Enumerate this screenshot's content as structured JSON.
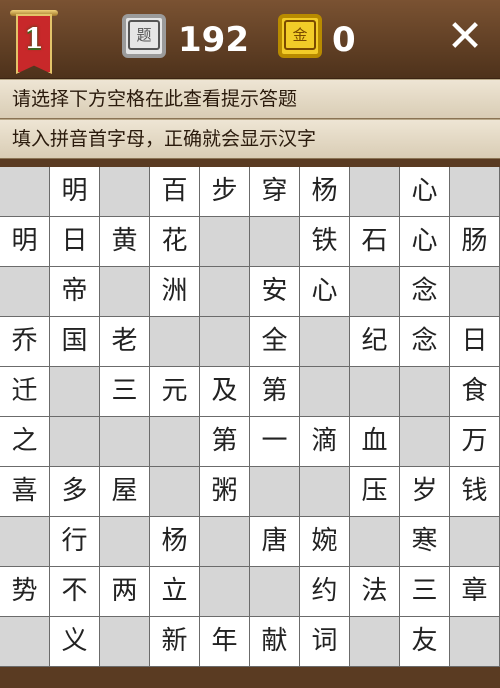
{
  "header": {
    "level": "1",
    "question_icon_glyph": "题",
    "question_count": "192",
    "gold_icon_glyph": "金",
    "gold_count": "0",
    "close_glyph": "✕"
  },
  "hints": [
    "请选择下方空格在此查看提示答题",
    "填入拼音首字母，正确就会显示汉字"
  ],
  "colors": {
    "wood": "#5a3b22",
    "cell_filled": "#ffffff",
    "cell_empty": "#d6d6d6",
    "level_banner": "#c8282a",
    "gold_badge": "#f2cc28"
  },
  "grid": [
    [
      "",
      "明",
      "",
      "百",
      "步",
      "穿",
      "杨",
      "",
      "心",
      ""
    ],
    [
      "明",
      "日",
      "黄",
      "花",
      "",
      "",
      "铁",
      "石",
      "心",
      "肠"
    ],
    [
      "",
      "帝",
      "",
      "洲",
      "",
      "安",
      "心",
      "",
      "念",
      ""
    ],
    [
      "乔",
      "国",
      "老",
      "",
      "",
      "全",
      "",
      "纪",
      "念",
      "日"
    ],
    [
      "迁",
      "",
      "三",
      "元",
      "及",
      "第",
      "",
      "",
      "",
      "食"
    ],
    [
      "之",
      "",
      "",
      "",
      "第",
      "一",
      "滴",
      "血",
      "",
      "万"
    ],
    [
      "喜",
      "多",
      "屋",
      "",
      "粥",
      "",
      "",
      "压",
      "岁",
      "钱"
    ],
    [
      "",
      "行",
      "",
      "杨",
      "",
      "唐",
      "婉",
      "",
      "寒",
      ""
    ],
    [
      "势",
      "不",
      "两",
      "立",
      "",
      "",
      "约",
      "法",
      "三",
      "章"
    ],
    [
      "",
      "义",
      "",
      "新",
      "年",
      "献",
      "词",
      "",
      "友",
      ""
    ]
  ]
}
